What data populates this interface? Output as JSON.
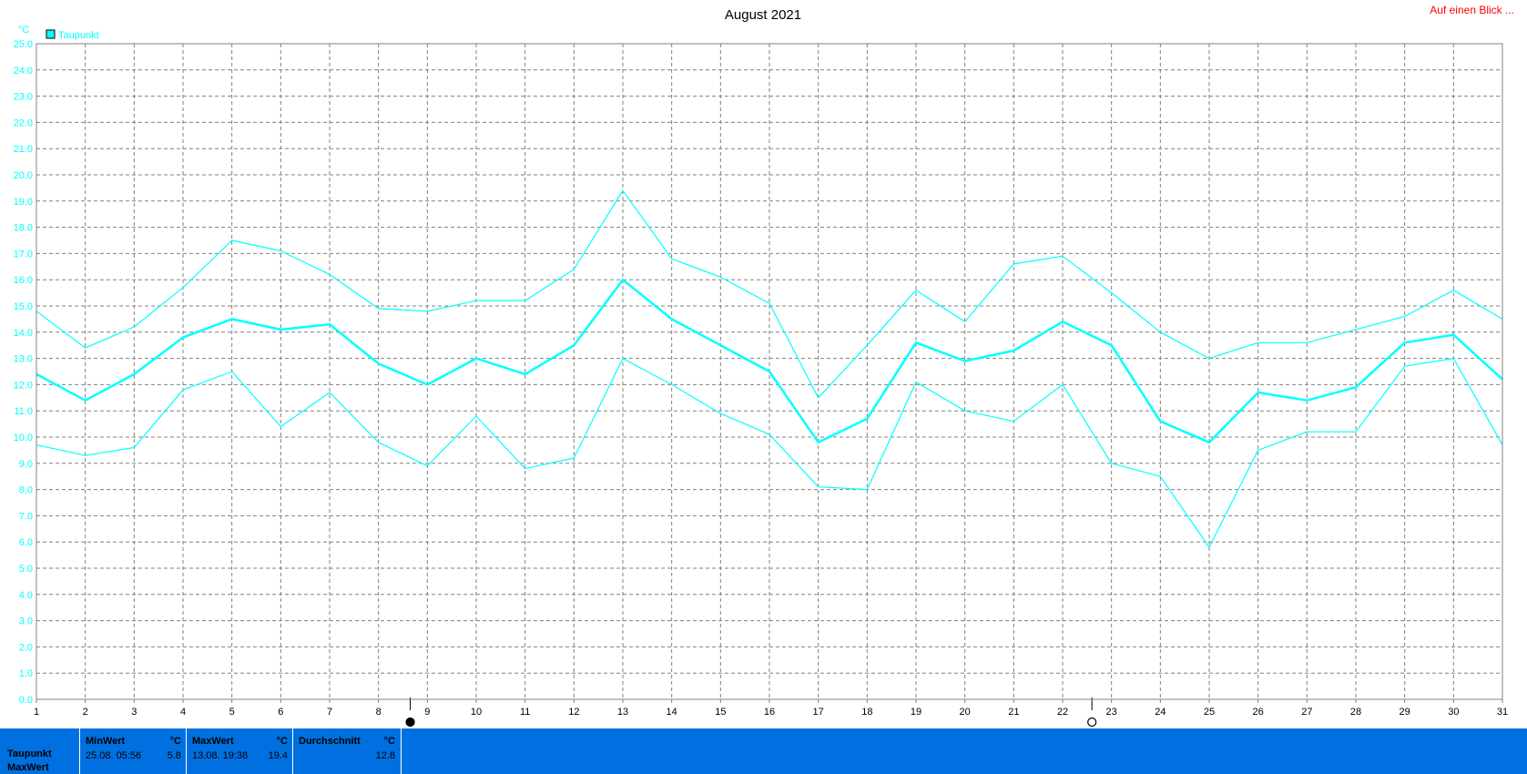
{
  "header": {
    "title": "August 2021",
    "link": "Auf einen Blick ..."
  },
  "colors": {
    "series": "#00ffff",
    "grid": "#808080",
    "stats_bg": "#0070e0",
    "link": "#ff0000"
  },
  "chart_data": {
    "type": "line",
    "title": "August 2021",
    "ylabel": "°C",
    "ylim": [
      0,
      25
    ],
    "yticks": [
      "0.0",
      "1.0",
      "2.0",
      "3.0",
      "4.0",
      "5.0",
      "6.0",
      "7.0",
      "8.0",
      "9.0",
      "10.0",
      "11.0",
      "12.0",
      "13.0",
      "14.0",
      "15.0",
      "16.0",
      "17.0",
      "18.0",
      "19.0",
      "20.0",
      "21.0",
      "22.0",
      "23.0",
      "24.0",
      "25.0"
    ],
    "x": [
      1,
      2,
      3,
      4,
      5,
      6,
      7,
      8,
      9,
      10,
      11,
      12,
      13,
      14,
      15,
      16,
      17,
      18,
      19,
      20,
      21,
      22,
      23,
      24,
      25,
      26,
      27,
      28,
      29,
      30,
      31
    ],
    "grid": true,
    "legend": [
      {
        "label": "Taupunkt"
      }
    ],
    "series": [
      {
        "role": "max",
        "values": [
          14.8,
          13.4,
          14.2,
          15.7,
          17.5,
          17.1,
          16.2,
          14.9,
          14.8,
          15.2,
          15.2,
          16.4,
          19.4,
          16.8,
          16.1,
          15.1,
          11.5,
          13.5,
          15.6,
          14.4,
          16.6,
          16.9,
          15.5,
          14.0,
          13.0,
          13.6,
          13.6,
          14.1,
          14.6,
          15.6,
          14.5
        ]
      },
      {
        "role": "avg",
        "values": [
          12.4,
          11.4,
          12.4,
          13.8,
          14.5,
          14.1,
          14.3,
          12.8,
          12.0,
          13.0,
          12.4,
          13.5,
          16.0,
          14.5,
          13.5,
          12.5,
          9.8,
          10.7,
          13.6,
          12.9,
          13.3,
          14.4,
          13.5,
          10.6,
          9.8,
          11.7,
          11.4,
          11.9,
          13.6,
          13.9,
          12.2
        ]
      },
      {
        "role": "min",
        "values": [
          9.7,
          9.3,
          9.6,
          11.8,
          12.5,
          10.4,
          11.7,
          9.8,
          8.9,
          10.8,
          8.8,
          9.2,
          13.0,
          12.0,
          10.9,
          10.1,
          8.1,
          8.0,
          12.1,
          11.0,
          10.6,
          12.0,
          9.0,
          8.5,
          5.8,
          9.5,
          10.2,
          10.2,
          12.7,
          13.0,
          9.7
        ]
      }
    ],
    "markers": [
      {
        "x": 8.65,
        "kind": "new-moon"
      },
      {
        "x": 22.6,
        "kind": "full-moon"
      }
    ]
  },
  "stats": {
    "row_labels": [
      "Taupunkt",
      "MaxWert"
    ],
    "min": {
      "header": "MinWert",
      "unit": "°C",
      "when": "25.08.  05:56",
      "value": "5.8"
    },
    "max": {
      "header": "MaxWert",
      "unit": "°C",
      "when": "13.08.  19:38",
      "value": "19.4"
    },
    "avg": {
      "header": "Durchschnitt",
      "unit": "°C",
      "value": "12.8"
    }
  }
}
